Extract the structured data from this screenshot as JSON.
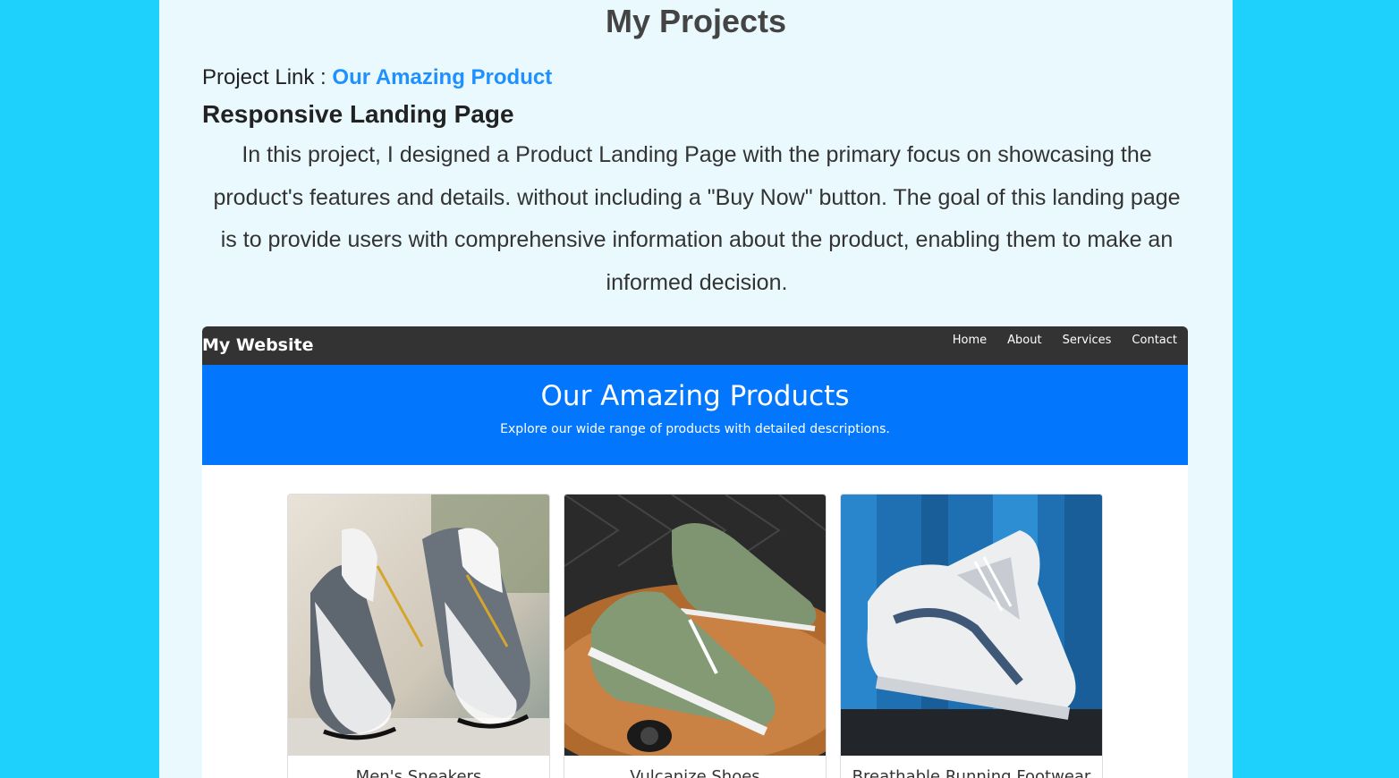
{
  "page": {
    "title": "My Projects",
    "project_link_label": "Project Link : ",
    "project_link_text": "Our Amazing Product",
    "project_heading": "Responsive Landing Page",
    "project_description": "In this project, I designed a Product Landing Page with the primary focus on showcasing the product's features and details. without including a \"Buy Now\" button. The goal of this landing page is to provide users with comprehensive information about the product, enabling them to make an informed decision."
  },
  "preview": {
    "brand": "My Website",
    "nav": [
      "Home",
      "About",
      "Services",
      "Contact"
    ],
    "hero_title": "Our Amazing Products",
    "hero_subtitle": "Explore our wide range of products with detailed descriptions.",
    "products": [
      {
        "name": "Men's Sneakers"
      },
      {
        "name": "Vulcanize Shoes"
      },
      {
        "name": "Breathable Running Footwear"
      }
    ]
  },
  "colors": {
    "outer_bg": "#1ed1fd",
    "page_bg": "#e9f9fe",
    "link": "#1e90ff",
    "nav_bg": "#333333",
    "hero_bg": "#0277fe"
  }
}
